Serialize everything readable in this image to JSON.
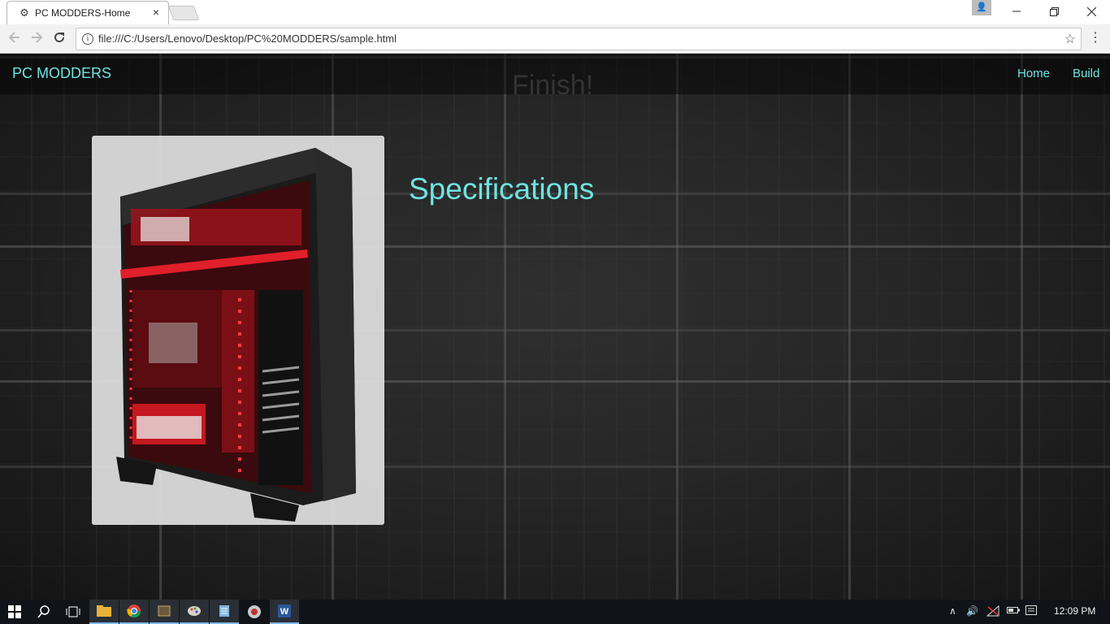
{
  "browser": {
    "tab_title": "PC MODDERS-Home",
    "tab_close": "×",
    "url": "file:///C:/Users/Lenovo/Desktop/PC%20MODDERS/sample.html"
  },
  "page": {
    "brand": "PC MODDERS",
    "nav": [
      {
        "label": "Home"
      },
      {
        "label": "Build"
      }
    ],
    "ghost_heading": "Finish!",
    "section_title": "Specifications",
    "image_alt": "gaming PC case with red lighting"
  },
  "taskbar": {
    "clock": "12:09 PM",
    "icons": [
      "windows-start-icon",
      "search-icon",
      "task-view-icon",
      "file-explorer-icon",
      "chrome-icon",
      "app-icon",
      "paint-icon",
      "notepad-icon",
      "game-icon",
      "word-icon"
    ]
  },
  "colors": {
    "accent": "#6fe3e0",
    "background": "#202020"
  }
}
